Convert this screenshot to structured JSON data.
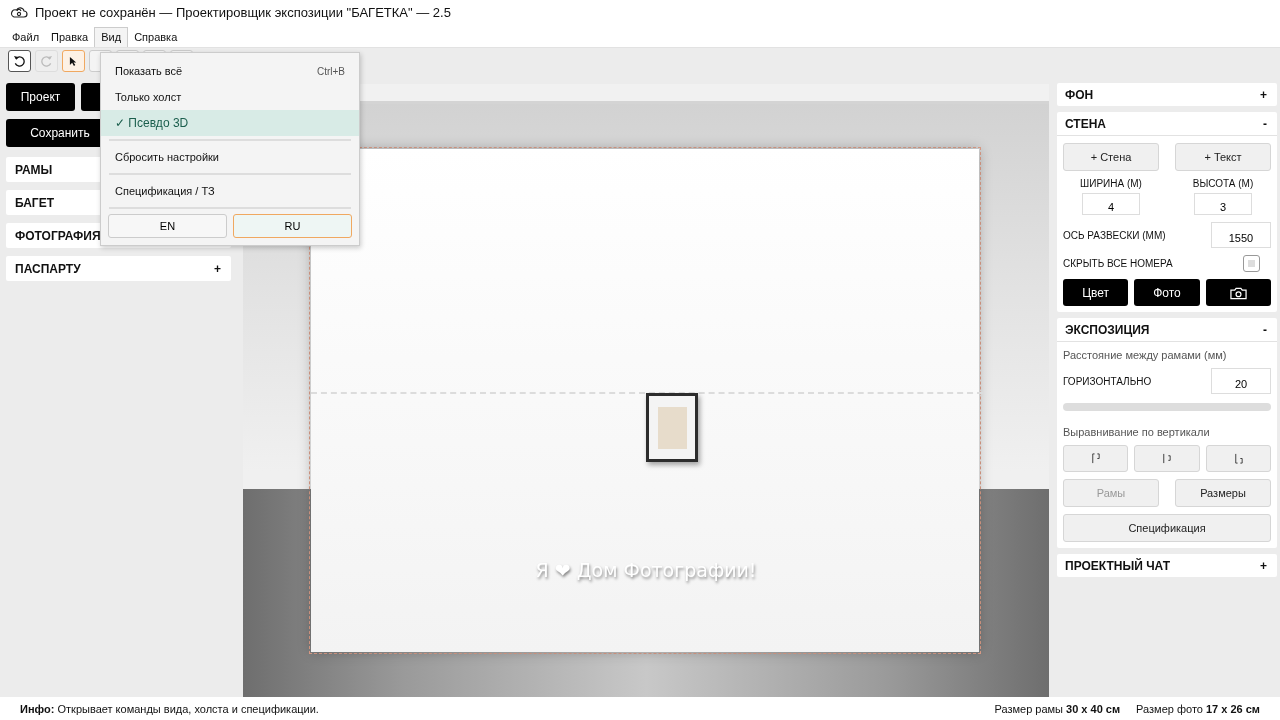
{
  "window": {
    "title": "Проект не сохранён — Проектировщик экспозиции \"БАГЕТКА\"  — 2.5"
  },
  "menu_bar": [
    {
      "label": "Файл",
      "selected": false
    },
    {
      "label": "Правка",
      "selected": false
    },
    {
      "label": "Вид",
      "selected": true
    },
    {
      "label": "Справка",
      "selected": false
    }
  ],
  "toolbar": [
    {
      "kind": "undo",
      "disabled": false,
      "selected": false
    },
    {
      "kind": "redo",
      "disabled": true,
      "selected": false
    },
    {
      "kind": "pointer",
      "disabled": false,
      "selected": true
    },
    {
      "kind": "blank",
      "disabled": false,
      "selected": false
    },
    {
      "kind": "blank",
      "disabled": false,
      "selected": false
    },
    {
      "kind": "blank",
      "disabled": false,
      "selected": false
    },
    {
      "kind": "blank",
      "disabled": false,
      "selected": false
    }
  ],
  "view_menu": {
    "items": [
      {
        "kind": "item",
        "label": "Показать всё",
        "shortcut": "Ctrl+B",
        "checked": false
      },
      {
        "kind": "item",
        "label": "Только холст",
        "checked": false
      },
      {
        "kind": "item",
        "label": "Псевдо 3D",
        "checked": true,
        "mark": "✓"
      },
      {
        "kind": "separator"
      },
      {
        "kind": "item",
        "label": "Сбросить настройки",
        "checked": false
      },
      {
        "kind": "separator"
      },
      {
        "kind": "item",
        "label": "Спецификация / ТЗ",
        "checked": false
      },
      {
        "kind": "separator"
      }
    ],
    "languages": [
      {
        "label": "EN",
        "selected": false
      },
      {
        "label": "RU",
        "selected": true
      }
    ]
  },
  "left_panel": {
    "buttons": [
      {
        "kind": "text",
        "label": "Проект"
      },
      {
        "kind": "covered"
      }
    ],
    "save_button": "Сохранить",
    "sections": [
      {
        "title": "РАМЫ"
      },
      {
        "title": "БАГЕТ"
      },
      {
        "title": "ФОТОГРАФИЯ"
      },
      {
        "title": "ПАСПАРТУ",
        "toggle": "+"
      }
    ]
  },
  "canvas": {
    "caption": "Я ❤ Дом Фотографии!"
  },
  "right_panel": {
    "background": {
      "title": "ФОН",
      "toggle": "+"
    },
    "wall": {
      "title": "СТЕНА",
      "toggle": "-",
      "add_buttons": [
        "+ Стена",
        "+ Текст"
      ],
      "width": {
        "label": "ШИРИНА (М)",
        "value": "4"
      },
      "height": {
        "label": "ВЫСОТА (М)",
        "value": "3"
      },
      "axis": {
        "label": "ОСЬ РАЗВЕСКИ (ММ)",
        "value": "1550"
      },
      "hide_numbers": {
        "label": "СКРЫТЬ ВСЕ НОМЕРА",
        "checked": false
      },
      "buttons": [
        {
          "kind": "text",
          "label": "Цвет"
        },
        {
          "kind": "text",
          "label": "Фото"
        },
        {
          "kind": "camera"
        }
      ]
    },
    "exposition": {
      "title": "ЭКСПОЗИЦИЯ",
      "toggle": "-",
      "spacing_label": "Расстояние между рамами (мм)",
      "horizontal": {
        "label": "ГОРИЗОНТАЛЬНО",
        "value": "20"
      },
      "align_label": "Выравнивание по вертикали",
      "align_buttons": [
        {
          "kind": "top"
        },
        {
          "kind": "middle"
        },
        {
          "kind": "bottom"
        }
      ],
      "buttons": [
        {
          "label": "Рамы",
          "disabled": true
        },
        {
          "label": "Размеры",
          "disabled": false
        }
      ],
      "spec_button": "Спецификация"
    },
    "chat": {
      "title": "ПРОЕКТНЫЙ ЧАТ",
      "toggle": "+"
    }
  },
  "status_bar": {
    "info": "**Инфо:** Открывает команды вида, холста и спецификации.",
    "frame_size": "Размер рамы  **30 x 40 см**",
    "photo_size": "Размер фото  **17 x 26 см**"
  }
}
